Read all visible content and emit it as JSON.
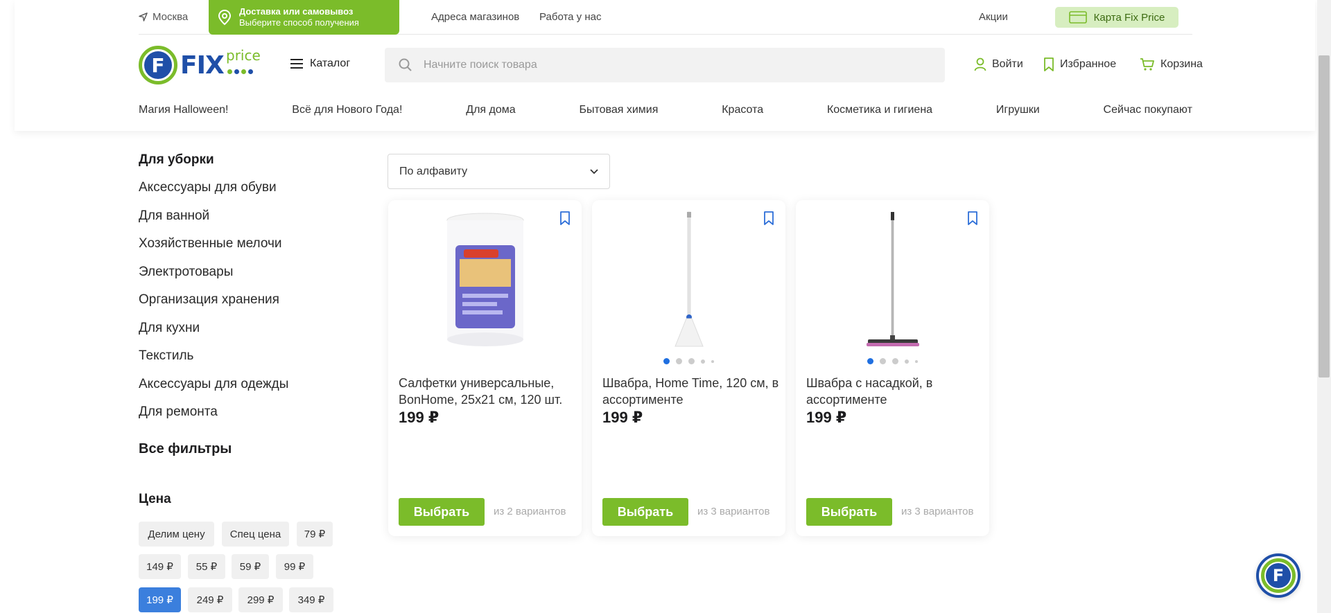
{
  "topbar": {
    "city": "Москва",
    "delivery_title": "Доставка или самовывоз",
    "delivery_sub": "Выберите способ получения",
    "links": [
      "Адреса магазинов",
      "Работа у нас"
    ],
    "promo": "Акции",
    "fix_card": "Карта Fix Price"
  },
  "header": {
    "logo_text": "FIX",
    "logo_price": "price",
    "logo_letter": "F",
    "catalog": "Каталог",
    "search_placeholder": "Начните поиск товара",
    "login": "Войти",
    "favorites": "Избранное",
    "cart": "Корзина"
  },
  "nav": [
    "Магия Halloween!",
    "Всё для Нового Года!",
    "Для дома",
    "Бытовая химия",
    "Красота",
    "Косметика и гигиена",
    "Игрушки",
    "Сейчас покупают"
  ],
  "sidebar": {
    "heading": "Для уборки",
    "items": [
      "Аксессуары для обуви",
      "Для ванной",
      "Хозяйственные мелочи",
      "Электротовары",
      "Организация хранения",
      "Для кухни",
      "Текстиль",
      "Аксессуары для одежды",
      "Для ремонта"
    ],
    "all_filters": "Все фильтры",
    "price_heading": "Цена",
    "price_chips": [
      "Делим цену",
      "Спец цена",
      "79 ₽",
      "149 ₽",
      "55 ₽",
      "59 ₽",
      "99 ₽",
      "199 ₽",
      "249 ₽",
      "299 ₽",
      "349 ₽"
    ],
    "active_chip": "199 ₽"
  },
  "sort": {
    "selected": "По алфавиту"
  },
  "products": [
    {
      "title": "Салфетки универсальные, BonHome, 25x21 см, 120 шт.",
      "price": "199 ₽",
      "button": "Выбрать",
      "variants": "из 2 вариантов",
      "image": "wipes-roll"
    },
    {
      "title": "Швабра, Home Time, 120 см, в ассортименте",
      "price": "199 ₽",
      "button": "Выбрать",
      "variants": "из 3 вариантов",
      "image": "string-mop"
    },
    {
      "title": "Швабра с насадкой, в ассортименте",
      "price": "199 ₽",
      "button": "Выбрать",
      "variants": "из 3 вариантов",
      "image": "flat-mop"
    }
  ],
  "colors": {
    "brand_green": "#7bbc2a",
    "brand_blue": "#1f4fa8",
    "active_chip": "#3b7fdd"
  }
}
